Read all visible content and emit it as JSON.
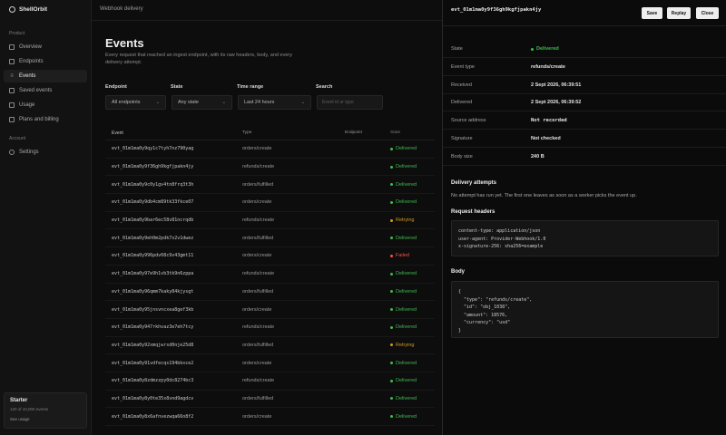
{
  "app": {
    "name": "ShellOrbit",
    "breadcrumb": "Webhook delivery"
  },
  "colors": {
    "delivered": "#3fb950",
    "retrying": "#d29922",
    "failed": "#f85149"
  },
  "sidebar": {
    "section_product": "Product",
    "items": [
      {
        "label": "Overview",
        "icon": "overview-icon"
      },
      {
        "label": "Endpoints",
        "icon": "endpoints-icon"
      },
      {
        "label": "Events",
        "icon": "events-icon",
        "active": true
      },
      {
        "label": "Saved events",
        "icon": "saved-icon"
      },
      {
        "label": "Usage",
        "icon": "usage-icon"
      },
      {
        "label": "Plans and billing",
        "icon": "billing-icon"
      }
    ],
    "section_account": "Account",
    "settings": {
      "label": "Settings",
      "icon": "gear-icon"
    },
    "plan": {
      "title": "Starter",
      "usage": "120 of 10,000 events",
      "link": "See usage"
    }
  },
  "main": {
    "title": "Events",
    "description": "Every request that reached an ingest endpoint, with its raw headers, body, and every delivery attempt.",
    "filters": {
      "endpoint": {
        "label": "Endpoint",
        "value": "All endpoints"
      },
      "state": {
        "label": "State",
        "value": "Any state"
      },
      "range": {
        "label": "Time range",
        "value": "Last 24 hours"
      },
      "search": {
        "label": "Search",
        "placeholder": "Event id or type"
      }
    },
    "columns": {
      "event": "Event",
      "type": "Type",
      "endpoint": "Endpoint",
      "state": "State"
    },
    "rows": [
      {
        "id": "evt_01m1ma0y9qy1c7tyh7nz790yag",
        "type": "orders/create",
        "state": "Delivered",
        "status": "delivered"
      },
      {
        "id": "evt_01m1ma0y9f36gh9kgfjpakn4jy",
        "type": "refunds/create",
        "state": "Delivered",
        "status": "delivered"
      },
      {
        "id": "evt_01m1ma0y9c0y1gv4tn8frq3t3h",
        "type": "orders/fulfilled",
        "state": "Delivered",
        "status": "delivered"
      },
      {
        "id": "evt_01m1ma0y9db4cm89tk33fkce07",
        "type": "orders/create",
        "state": "Delivered",
        "status": "delivered"
      },
      {
        "id": "evt_01m1ma0y9bar6ec58v81ncrqdb",
        "type": "refunds/create",
        "state": "Retrying",
        "status": "retrying"
      },
      {
        "id": "evt_01m1ma0y9eh0m2pdk7x2v1dwez",
        "type": "orders/fulfilled",
        "state": "Delivered",
        "status": "delivered"
      },
      {
        "id": "evt_01m1ma0y996pdv08c9x43gmt11",
        "type": "orders/create",
        "state": "Failed",
        "status": "failed"
      },
      {
        "id": "evt_01m1ma0y97e9h1vb3tk9n6zppa",
        "type": "refunds/create",
        "state": "Delivered",
        "status": "delivered"
      },
      {
        "id": "evt_01m1ma0y96qmm7kaky84kjysgt",
        "type": "orders/fulfilled",
        "state": "Delivered",
        "status": "delivered"
      },
      {
        "id": "evt_01m1ma0y95jnsvncxea8gef3kb",
        "type": "orders/create",
        "state": "Delivered",
        "status": "delivered"
      },
      {
        "id": "evt_01m1ma0y947rkhvaz3e7eh7tcy",
        "type": "refunds/create",
        "state": "Delivered",
        "status": "delivered"
      },
      {
        "id": "evt_01m1ma0y92xmqjwrsd0nje25d8",
        "type": "orders/fulfilled",
        "state": "Retrying",
        "status": "retrying"
      },
      {
        "id": "evt_01m1ma0y91vdfecqs194bkxce2",
        "type": "orders/create",
        "state": "Delivered",
        "status": "delivered"
      },
      {
        "id": "evt_01m1ma0y8zdmzzpy0dc8274bc3",
        "type": "refunds/create",
        "state": "Delivered",
        "status": "delivered"
      },
      {
        "id": "evt_01m1ma0y8y0te35x8vnd9agdcv",
        "type": "orders/fulfilled",
        "state": "Delivered",
        "status": "delivered"
      },
      {
        "id": "evt_01m1ma0y8x6afnvezwqa66n8f2",
        "type": "orders/create",
        "state": "Delivered",
        "status": "delivered"
      }
    ]
  },
  "panel": {
    "title": "evt_01m1ma0y9f36gh9kgfjpakn4jy",
    "buttons": {
      "save": "Save",
      "replay": "Replay",
      "close": "Close"
    },
    "fields": [
      {
        "key": "State",
        "value": "Delivered",
        "status": "delivered"
      },
      {
        "key": "Event type",
        "value": "refunds/create"
      },
      {
        "key": "Received",
        "value": "2 Sept 2026, 06:39:51"
      },
      {
        "key": "Delivered",
        "value": "2 Sept 2026, 06:39:52"
      },
      {
        "key": "Source address",
        "value": "Not recorded",
        "mono": true
      },
      {
        "key": "Signature",
        "value": "Not checked"
      },
      {
        "key": "Body size",
        "value": "240 B"
      }
    ],
    "attempts_title": "Delivery attempts",
    "attempts_text": "No attempt has run yet. The first one leaves as soon as a worker picks the event up.",
    "headers_title": "Request headers",
    "headers_code": "content-type: application/json\nuser-agent: Provider-Webhook/1.0\nx-signature-256: sha256=example",
    "body_title": "Body",
    "body_code": "{\n  \"type\": \"refunds/create\",\n  \"id\": \"obj_1038\",\n  \"amount\": 18576,\n  \"currency\": \"usd\"\n}"
  }
}
